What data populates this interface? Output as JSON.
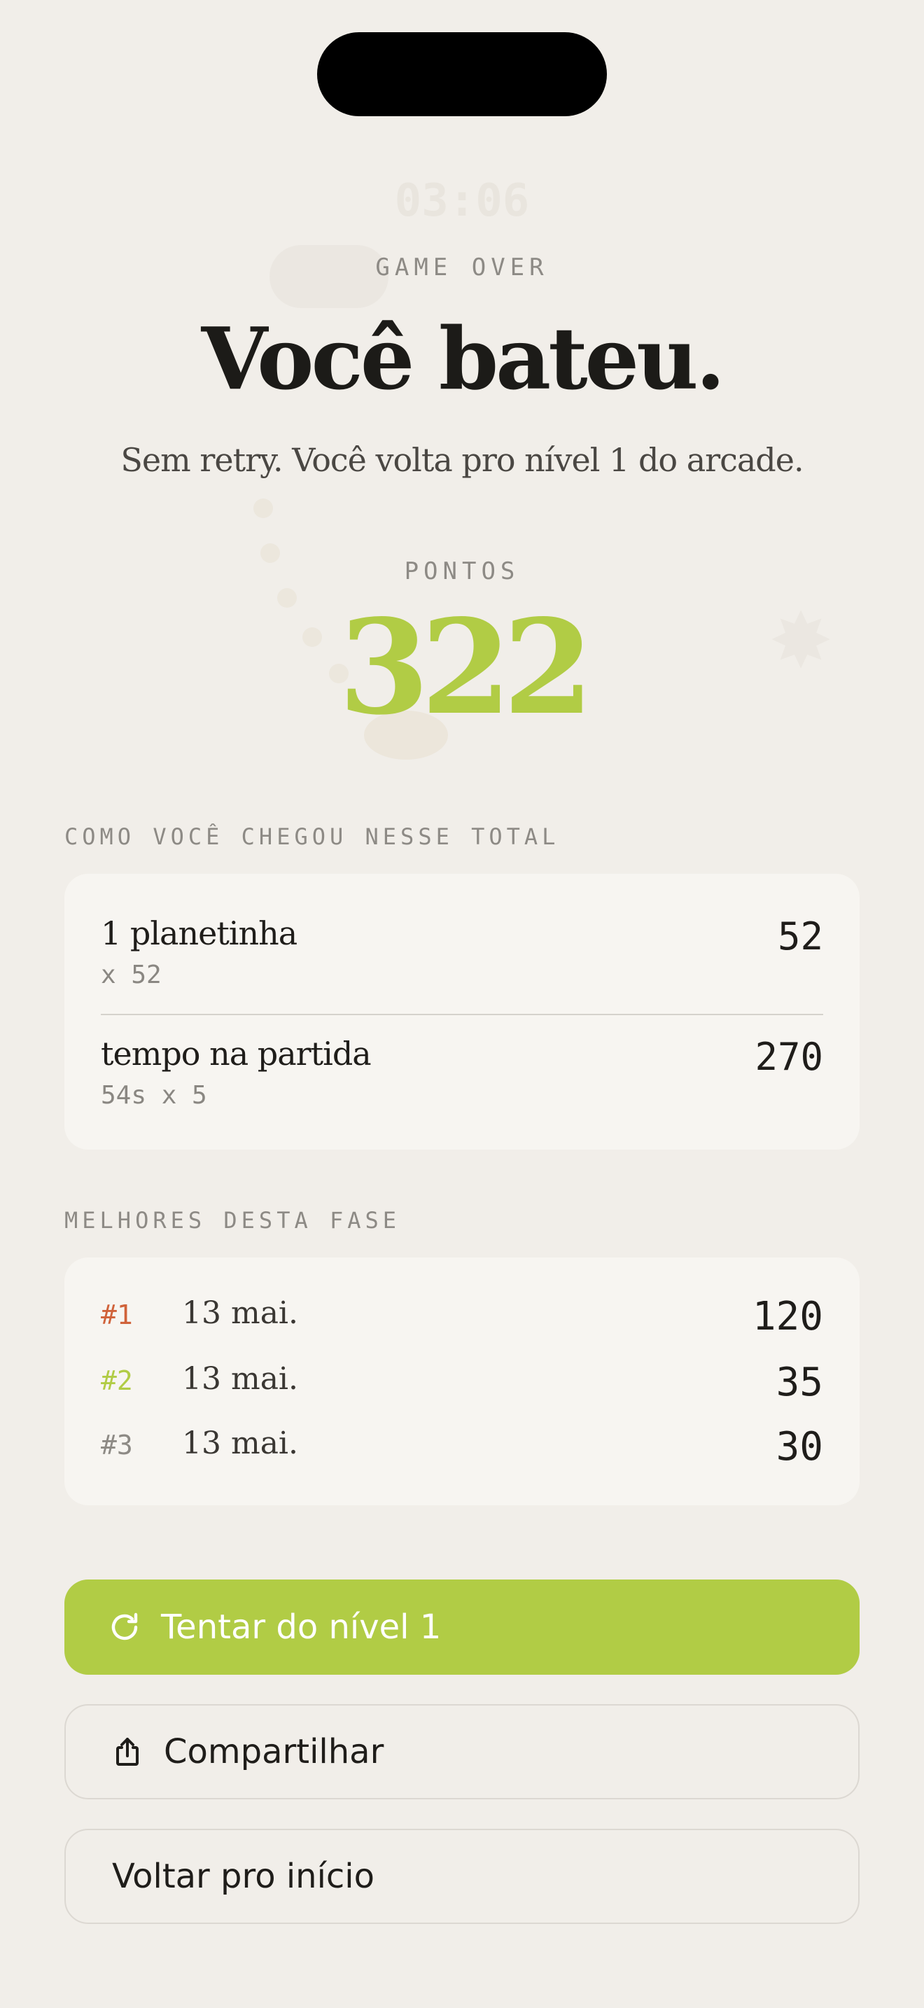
{
  "header": {
    "eyebrow": "GAME OVER",
    "title": "Você bateu.",
    "subtitle": "Sem retry. Você volta pro nível 1 do arcade."
  },
  "score": {
    "label": "PONTOS",
    "value": "322"
  },
  "breakdown": {
    "label": "COMO VOCÊ CHEGOU NESSE TOTAL",
    "items": [
      {
        "name": "1 planetinha",
        "detail": "x 52",
        "value": "52"
      },
      {
        "name": "tempo na partida",
        "detail": "54s x 5",
        "value": "270"
      }
    ]
  },
  "best": {
    "label": "MELHORES DESTA FASE",
    "rows": [
      {
        "rank": "#1",
        "date": "13 mai.",
        "value": "120",
        "color": "#d0623a"
      },
      {
        "rank": "#2",
        "date": "13 mai.",
        "value": "35",
        "color": "#b1cc45"
      },
      {
        "rank": "#3",
        "date": "13 mai.",
        "value": "30",
        "color": "#8d8a85"
      }
    ]
  },
  "actions": {
    "retry_label": "Tentar do nível 1",
    "retry_icon": "refresh-icon",
    "share_label": "Compartilhar",
    "share_icon": "share-icon",
    "home_label": "Voltar pro início"
  },
  "colors": {
    "accent": "#b1cc45",
    "background": "#f1eee9",
    "card": "#f7f5f1"
  }
}
